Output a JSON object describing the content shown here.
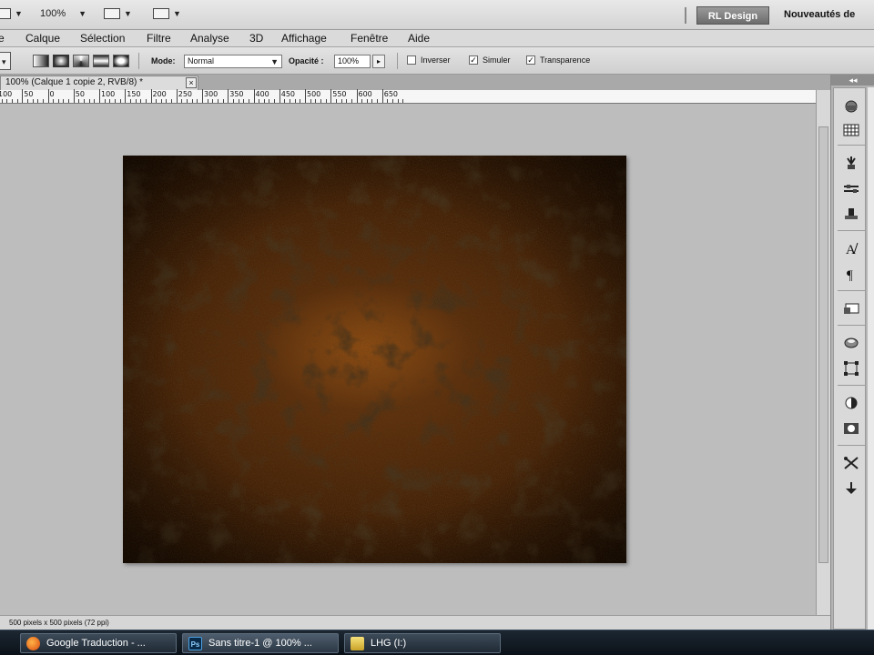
{
  "app_bar": {
    "zoom_value": "100%",
    "workspace_button": "RL Design",
    "workspace_label": "Nouveautés de"
  },
  "menu": {
    "items": [
      "Calque",
      "Sélection",
      "Filtre",
      "Analyse",
      "3D",
      "Affichage",
      "Fenêtre",
      "Aide"
    ]
  },
  "options_bar": {
    "mode_label": "Mode:",
    "mode_value": "Normal",
    "opacity_label": "Opacité :",
    "opacity_value": "100%",
    "checkboxes": [
      {
        "label": "Inverser",
        "checked": false
      },
      {
        "label": "Simuler",
        "checked": true
      },
      {
        "label": "Transparence",
        "checked": true
      }
    ]
  },
  "document": {
    "tab_title": "100% (Calque 1 copie 2, RVB/8) *",
    "close_glyph": "×"
  },
  "ruler": {
    "labels": [
      "100",
      "50",
      "0",
      "50",
      "100",
      "150",
      "200",
      "250",
      "300",
      "350",
      "400",
      "450",
      "500",
      "550",
      "600",
      "650"
    ]
  },
  "status": {
    "text": "500 pixels x 500 pixels (72 ppi)"
  },
  "panel_dock": {
    "collapse_glyph": "◂◂",
    "icons": [
      "styles-icon",
      "swatches-icon",
      "brush-presets-icon",
      "tool-presets-icon",
      "clone-source-icon",
      "character-icon",
      "paragraph-icon",
      "navigator-icon",
      "3d-icon",
      "transform-icon",
      "adjustments-icon",
      "masks-icon",
      "tools-icon",
      "actions-icon"
    ]
  },
  "taskbar": {
    "items": [
      {
        "label": "Google Traduction - ...",
        "icon": "firefox-icon",
        "badge": "",
        "active": false
      },
      {
        "label": "Sans titre-1 @ 100% ...",
        "icon": "photoshop-icon",
        "badge": "Ps",
        "active": true
      },
      {
        "label": "LHG (I:)",
        "icon": "folder-icon",
        "badge": "",
        "active": false
      }
    ]
  },
  "colors": {
    "texture_base": "#4a2509",
    "texture_highlight": "#aa5c14",
    "texture_dark": "#1a0a02",
    "workspace": "#bdbdbd"
  }
}
